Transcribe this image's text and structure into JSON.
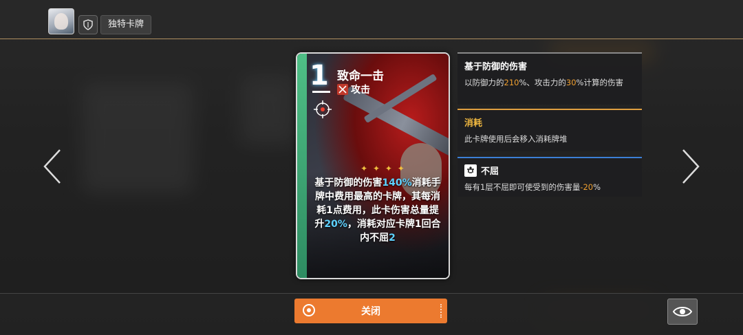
{
  "header": {
    "tag_label": "独特卡牌",
    "avatar_icon": "character-portrait",
    "shield_icon": "shield-icon"
  },
  "card": {
    "cost": "1",
    "name": "致命一击",
    "type_label": "攻击",
    "type_icon": "crossed-swords-icon",
    "ornament": "✦ ✦ ✦ ✦",
    "desc_parts": [
      {
        "text": "基于防御的伤害",
        "hl": false
      },
      {
        "text": "140%",
        "hl": true
      },
      {
        "text": "消耗手牌中费用最高的卡牌，其每消耗1点费用，此卡伤害总量提升",
        "hl": false
      },
      {
        "text": "20%",
        "hl": true
      },
      {
        "text": "，消耗对应卡牌1回合内不屈",
        "hl": false
      },
      {
        "text": "2",
        "hl": true
      }
    ]
  },
  "panels": [
    {
      "title": "基于防御的伤害",
      "body_parts": [
        {
          "text": "以防御力的",
          "num": false
        },
        {
          "text": "210",
          "num": true
        },
        {
          "text": "%、攻击力的",
          "num": false
        },
        {
          "text": "30",
          "num": true
        },
        {
          "text": "%计算的伤害",
          "num": false
        }
      ]
    },
    {
      "title": "消耗",
      "body_parts": [
        {
          "text": "此卡牌使用后会移入消耗牌堆",
          "num": false
        }
      ]
    },
    {
      "title": "不屈",
      "icon": "strength-icon",
      "body_parts": [
        {
          "text": "每有1层不屈即可使受到的伤害量",
          "num": false
        },
        {
          "text": "-20",
          "num": true
        },
        {
          "text": "%",
          "num": false
        }
      ]
    }
  ],
  "footer": {
    "close_label": "关闭",
    "eye_icon": "eye-icon"
  },
  "colors": {
    "accent_orange": "#ec7a2f",
    "highlight_blue": "#5ed1ff",
    "number_orange": "#f0a030"
  }
}
